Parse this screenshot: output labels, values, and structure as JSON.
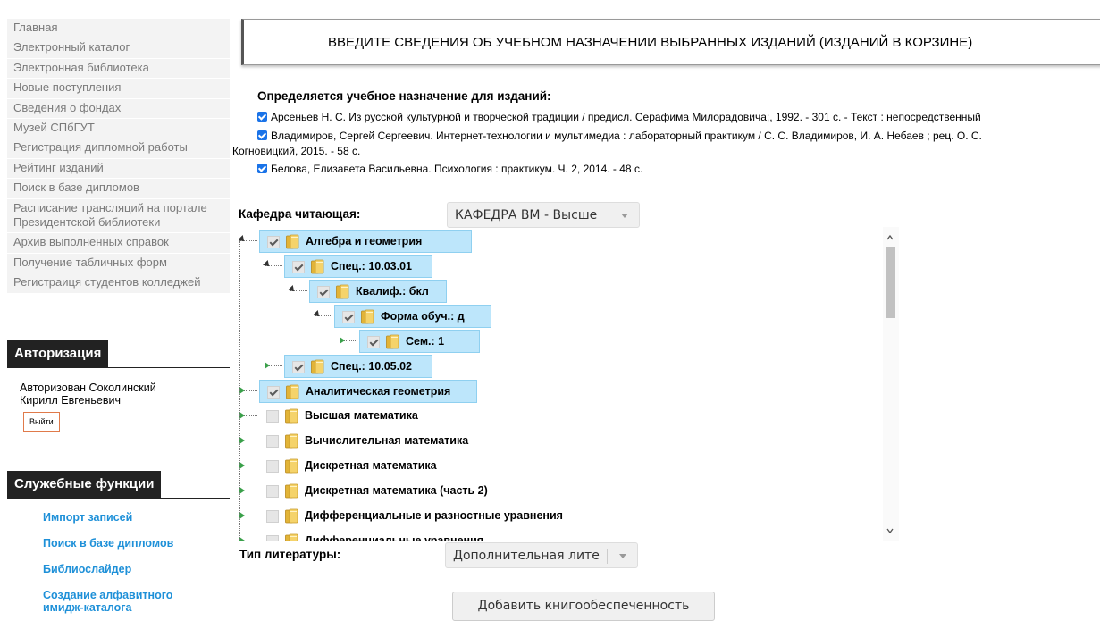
{
  "nav": {
    "items": [
      "Главная",
      "Электронный каталог",
      "Электронная библиотека",
      "Новые поступления",
      "Сведения о фондах",
      "Музей СПбГУТ",
      "Регистрация дипломной работы",
      "Рейтинг изданий",
      "Поиск в базе дипломов",
      "Расписание трансляций на портале Президентской библиотеки",
      "Архив выполненных справок",
      "Получение табличных форм",
      "Регистраиця студентов колледжей"
    ]
  },
  "auth": {
    "title": "Авторизация",
    "line1": "Авторизован Соколинский",
    "line2": "Кирилл Евгеньевич",
    "logout": "Выйти"
  },
  "service": {
    "title": "Служебные функции",
    "items": [
      "Импорт записей",
      "Поиск в базе дипломов",
      "Библиослайдер",
      "Создание алфавитного",
      "имидж-каталога"
    ]
  },
  "main": {
    "header": "ВВЕДИТЕ СВЕДЕНИЯ ОБ УЧЕБНОМ НАЗНАЧЕНИИ ВЫБРАННЫХ ИЗДАНИЙ (ИЗДАНИЙ В КОРЗИНЕ)",
    "selection_title": "Определяется учебное назначение для изданий:",
    "publications": [
      "Арсеньев Н. С. Из русской культурной и творческой традиции / предисл. Серафима Милорадовича;, 1992. - 301 с. - Текст : непосредственный",
      "Владимиров, Сергей Сергеевич. Интернет-технологии и мультимедиа : лабораторный практикум / С. С. Владимиров, И. А. Небаев ; рец. О. С.",
      "Когновицкий, 2015. - 58 с.",
      "Белова, Елизавета Васильевна. Психология : практикум. Ч. 2, 2014. - 48 с."
    ],
    "dept_label": "Кафедра читающая:",
    "dept_value": "КАФЕДРА ВМ - Высше",
    "tree": [
      "Алгебра и геометрия",
      "Спец.: 10.03.01",
      "Квалиф.: бкл",
      "Форма обуч.: д",
      "Сем.: 1",
      "Спец.: 10.05.02",
      "Аналитическая геометрия",
      "Высшая математика",
      "Вычислительная математика",
      "Дискретная математика",
      "Дискретная математика (часть 2)",
      "Дифференциальные и разностные уравнения",
      "Дифференциальные уравнения"
    ],
    "lit_label": "Тип литературы:",
    "lit_value": "Дополнительная лите",
    "add_button": "Добавить книгообеспеченность"
  },
  "colors": {
    "accent_blue": "#1e90d8",
    "selected_node": "#bde6fb",
    "header_dark": "#222222"
  }
}
